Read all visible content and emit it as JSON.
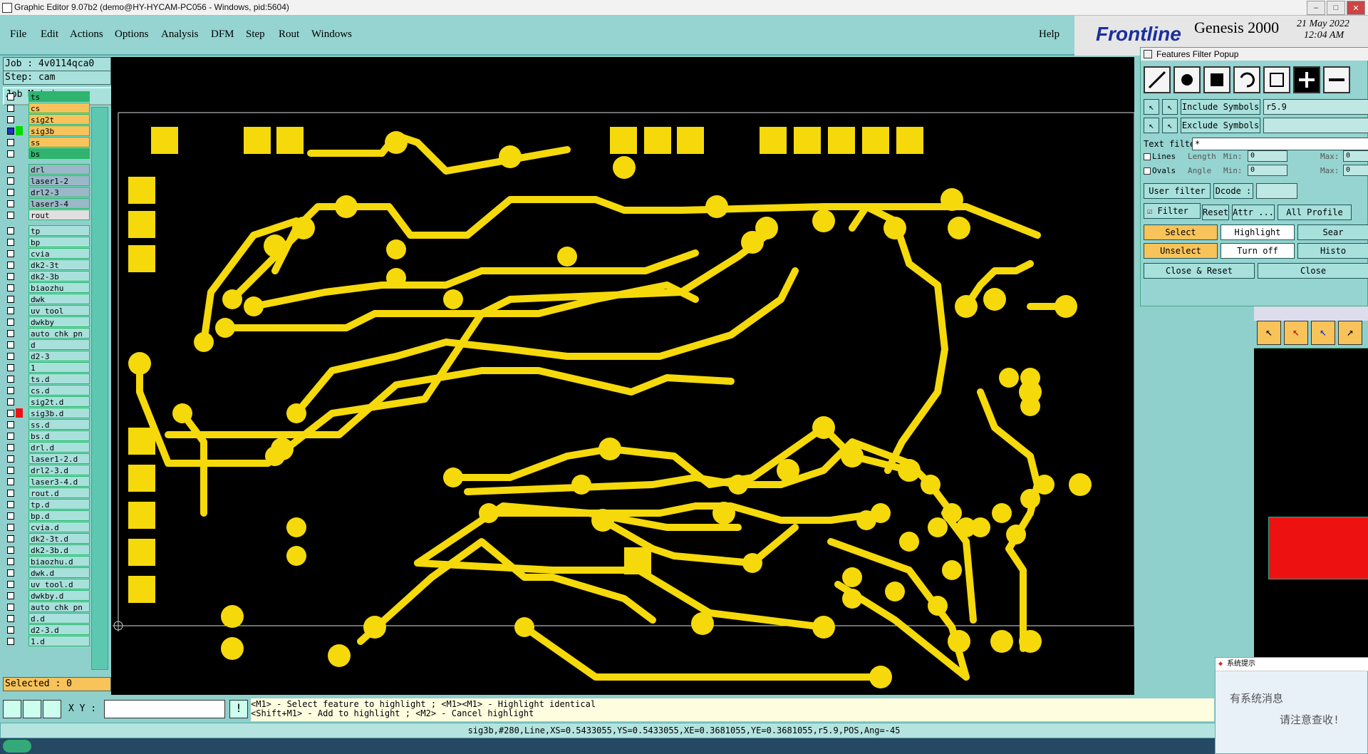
{
  "window": {
    "title": "Graphic Editor 9.07b2 (demo@HY-HYCAM-PC056 - Windows, pid:5604)"
  },
  "menu": {
    "items": [
      "File",
      "Edit",
      "Actions",
      "Options",
      "Analysis",
      "DFM",
      "Step",
      "Rout",
      "Windows"
    ],
    "help": "Help"
  },
  "brand": {
    "logo": "Frontline",
    "product": "Genesis 2000",
    "date": "21 May 2022",
    "time": "12:04 AM"
  },
  "job": {
    "job_label": "Job : 4v0114qca0",
    "step_label": "Step: cam",
    "matrix_button": "Job Matrix ..."
  },
  "layers": [
    {
      "name": "ts",
      "color": "#2fb36f"
    },
    {
      "name": "cs",
      "color": "#f7c35a"
    },
    {
      "name": "sig2t",
      "color": "#f7c35a"
    },
    {
      "name": "sig3b",
      "color": "#f7c35a",
      "active": true,
      "swatch": "#00dd00"
    },
    {
      "name": "ss",
      "color": "#f7c35a"
    },
    {
      "name": "bs",
      "color": "#2fb36f"
    },
    {
      "name": "drl",
      "color": "#9ab8c8"
    },
    {
      "name": "laser1-2",
      "color": "#9ab8c8"
    },
    {
      "name": "drl2-3",
      "color": "#9ab8c8"
    },
    {
      "name": "laser3-4",
      "color": "#9ab8c8"
    },
    {
      "name": "rout",
      "color": "#e0e0e0"
    },
    {
      "name": "tp",
      "color": "#a8e0dc"
    },
    {
      "name": "bp",
      "color": "#a8e0dc"
    },
    {
      "name": "cvia",
      "color": "#a8e0dc"
    },
    {
      "name": "dk2-3t",
      "color": "#a8e0dc"
    },
    {
      "name": "dk2-3b",
      "color": "#a8e0dc"
    },
    {
      "name": "biaozhu",
      "color": "#a8e0dc"
    },
    {
      "name": "dwk",
      "color": "#a8e0dc"
    },
    {
      "name": "uv_tool",
      "color": "#a8e0dc"
    },
    {
      "name": "dwkby",
      "color": "#a8e0dc"
    },
    {
      "name": "auto_chk_pn",
      "color": "#a8e0dc"
    },
    {
      "name": "d",
      "color": "#a8e0dc"
    },
    {
      "name": "d2-3",
      "color": "#a8e0dc"
    },
    {
      "name": "1",
      "color": "#a8e0dc"
    },
    {
      "name": "ts.d",
      "color": "#a8e0dc"
    },
    {
      "name": "cs.d",
      "color": "#a8e0dc"
    },
    {
      "name": "sig2t.d",
      "color": "#a8e0dc"
    },
    {
      "name": "sig3b.d",
      "color": "#a8e0dc",
      "swatch": "#ee1111"
    },
    {
      "name": "ss.d",
      "color": "#a8e0dc"
    },
    {
      "name": "bs.d",
      "color": "#a8e0dc"
    },
    {
      "name": "drl.d",
      "color": "#a8e0dc"
    },
    {
      "name": "laser1-2.d",
      "color": "#a8e0dc"
    },
    {
      "name": "drl2-3.d",
      "color": "#a8e0dc"
    },
    {
      "name": "laser3-4.d",
      "color": "#a8e0dc"
    },
    {
      "name": "rout.d",
      "color": "#a8e0dc"
    },
    {
      "name": "tp.d",
      "color": "#a8e0dc"
    },
    {
      "name": "bp.d",
      "color": "#a8e0dc"
    },
    {
      "name": "cvia.d",
      "color": "#a8e0dc"
    },
    {
      "name": "dk2-3t.d",
      "color": "#a8e0dc"
    },
    {
      "name": "dk2-3b.d",
      "color": "#a8e0dc"
    },
    {
      "name": "biaozhu.d",
      "color": "#a8e0dc"
    },
    {
      "name": "dwk.d",
      "color": "#a8e0dc"
    },
    {
      "name": "uv_tool.d",
      "color": "#a8e0dc"
    },
    {
      "name": "dwkby.d",
      "color": "#a8e0dc"
    },
    {
      "name": "auto_chk_pn",
      "color": "#a8e0dc"
    },
    {
      "name": "d.d",
      "color": "#a8e0dc"
    },
    {
      "name": "d2-3.d",
      "color": "#a8e0dc"
    },
    {
      "name": "1.d",
      "color": "#a8e0dc"
    }
  ],
  "selected": "Selected : 0",
  "filter": {
    "title": "Features Filter Popup",
    "include_label": "Include Symbols :",
    "include_value": "r5.9",
    "exclude_label": "Exclude Symbols :",
    "exclude_value": "",
    "text_filter_label": "Text filter",
    "text_filter_value": "*",
    "lines": "Lines",
    "ovals": "Ovals",
    "length": "Length",
    "angle": "Angle",
    "min": "Min:",
    "max": "Max:",
    "min_val": "0",
    "max_val": "0",
    "user_filter": "User filter ...",
    "dcode": "Dcode :",
    "filter": "Filter",
    "reset": "Reset",
    "attr": "Attr ...",
    "all_profile": "All Profile",
    "select": "Select",
    "highlight": "Highlight",
    "search": "Sear",
    "unselect": "Unselect",
    "turn_off": "Turn off",
    "histo": "Histo",
    "close_reset": "Close & Reset",
    "close": "Close"
  },
  "command": {
    "xy_label": "X Y :",
    "hint1": "<M1> - Select feature to highlight ; <M1><M1> - Highlight identical",
    "hint2": "<Shift+M1> - Add to highlight ; <M2> - Cancel highlight"
  },
  "status": "sig3b,#280,Line,XS=0.5433055,YS=0.5433055,XE=0.3681055,YE=0.3681055,r5.9,POS,Ang=-45",
  "notice": {
    "header": "系统提示",
    "line1": "有系统消息",
    "line2": "请注意查收!"
  },
  "colors": {
    "copper": "#f5d90a",
    "canvas": "#000000",
    "panel": "#8fd0cc"
  }
}
